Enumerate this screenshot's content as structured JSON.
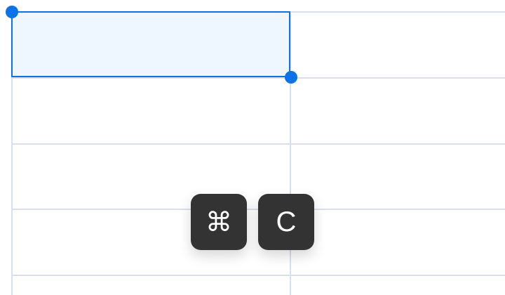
{
  "spreadsheet": {
    "selection": {
      "description": "selected cell"
    }
  },
  "keyboard_shortcut": {
    "keys": [
      {
        "name": "command",
        "label": "⌘"
      },
      {
        "name": "c",
        "label": "C"
      }
    ]
  },
  "colors": {
    "grid": "#d9e0ec",
    "selection_fill": "#eef6ff",
    "selection_border": "#0b72e7",
    "key_bg": "#333333",
    "key_text": "#ffffff"
  }
}
